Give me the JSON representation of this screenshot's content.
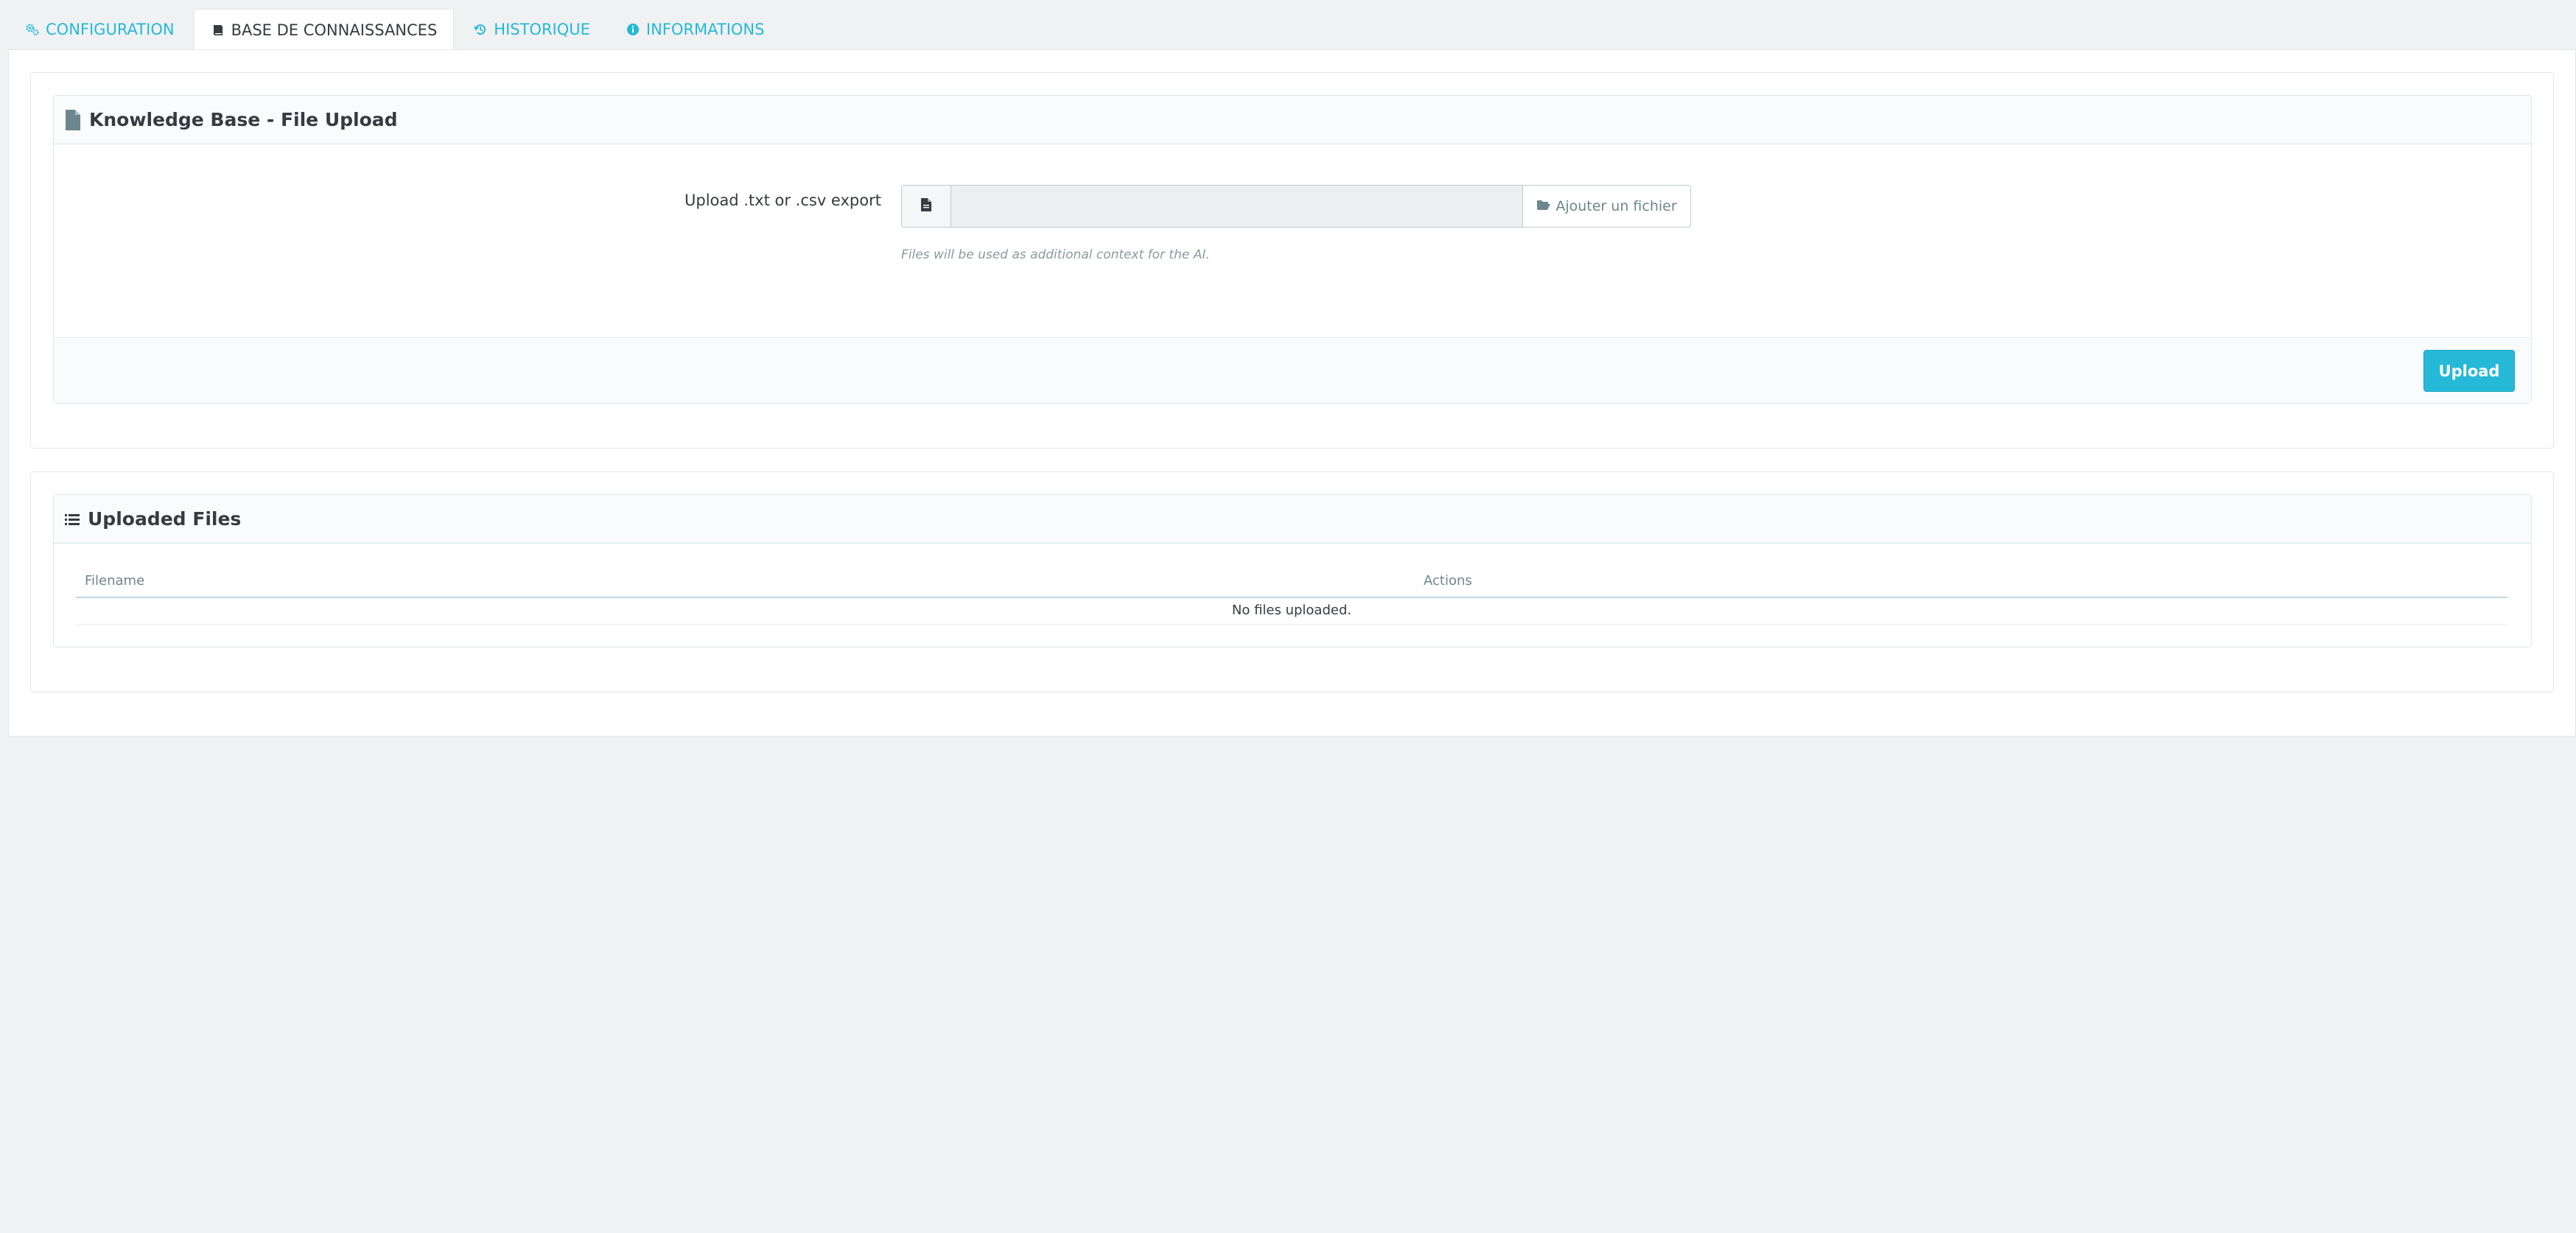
{
  "tabs": [
    {
      "label": "CONFIGURATION",
      "icon": "cogs-icon",
      "active": false
    },
    {
      "label": "BASE DE CONNAISSANCES",
      "icon": "book-icon",
      "active": true
    },
    {
      "label": "HISTORIQUE",
      "icon": "history-icon",
      "active": false
    },
    {
      "label": "INFORMATIONS",
      "icon": "info-circle-icon",
      "active": false
    }
  ],
  "upload_panel": {
    "title": "Knowledge Base - File Upload",
    "field_label": "Upload .txt or .csv export",
    "file_input_value": "",
    "add_file_label": "Ajouter un fichier",
    "help_text": "Files will be used as additional context for the AI.",
    "submit_label": "Upload"
  },
  "files_panel": {
    "title": "Uploaded Files",
    "columns": [
      "Filename",
      "Actions"
    ],
    "empty_message": "No files uploaded."
  },
  "colors": {
    "accent": "#25b9d7",
    "background": "#eff1f2",
    "text": "#363a41"
  }
}
